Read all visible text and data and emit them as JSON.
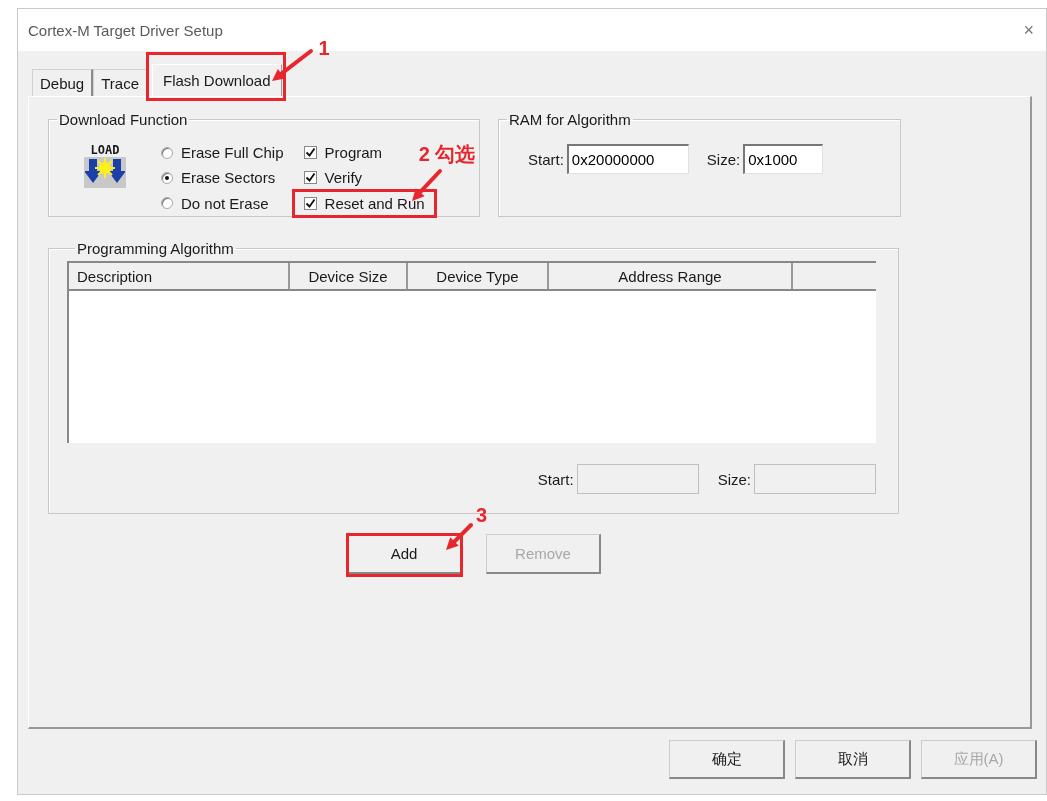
{
  "window": {
    "title": "Cortex-M Target Driver Setup",
    "close": "×"
  },
  "tabs": [
    {
      "label": "Debug",
      "selected": false
    },
    {
      "label": "Trace",
      "selected": false
    },
    {
      "label": "Flash Download",
      "selected": true,
      "callout": "1"
    }
  ],
  "download_function": {
    "title": "Download Function",
    "icon_label": "LOAD",
    "erase_options": [
      {
        "label": "Erase Full Chip",
        "selected": false
      },
      {
        "label": "Erase Sectors",
        "selected": true
      },
      {
        "label": "Do not Erase",
        "selected": false
      }
    ],
    "options": [
      {
        "label": "Program",
        "checked": true
      },
      {
        "label": "Verify",
        "checked": true
      },
      {
        "label": "Reset and Run",
        "checked": true,
        "callout": "2 勾选"
      }
    ]
  },
  "ram_for_algorithm": {
    "title": "RAM for Algorithm",
    "fields": [
      {
        "label": "Start:",
        "value": "0x20000000",
        "disabled": false
      },
      {
        "label": "Size:",
        "value": "0x1000",
        "disabled": false
      }
    ]
  },
  "programming_algorithm": {
    "title": "Programming Algorithm",
    "table": {
      "columns": [
        "Description",
        "Device Size",
        "Device Type",
        "Address Range"
      ]
    },
    "fields": [
      {
        "label": "Start:",
        "disabled": true
      },
      {
        "label": "Size:",
        "disabled": true
      }
    ]
  },
  "algorithm_buttons": [
    {
      "label": "Add",
      "disabled": false,
      "callout": "3"
    },
    {
      "label": "Remove",
      "disabled": true
    }
  ],
  "dialog_buttons": [
    {
      "label": "确定",
      "disabled": false
    },
    {
      "label": "取消",
      "disabled": false
    },
    {
      "label": "应用(A)",
      "disabled": true
    }
  ]
}
